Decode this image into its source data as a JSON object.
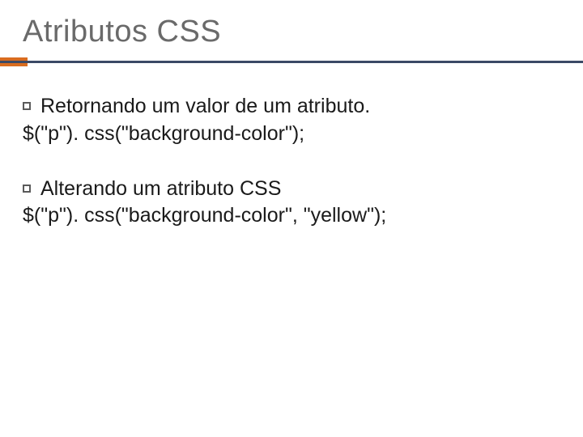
{
  "title": "Atributos CSS",
  "items": [
    {
      "heading": "Retornando um valor de um atributo.",
      "code": "$(\"p\"). css(\"background-color\");"
    },
    {
      "heading": "Alterando um atributo CSS",
      "code": "$(\"p\"). css(\"background-color\", \"yellow\");"
    }
  ]
}
